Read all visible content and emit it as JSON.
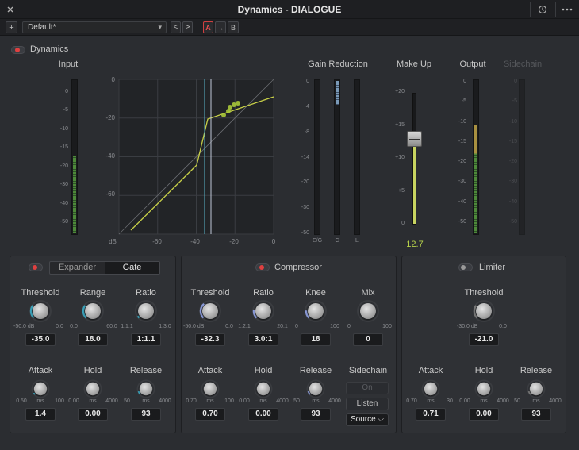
{
  "window": {
    "title": "Dynamics - DIALOGUE"
  },
  "icons": {
    "close": "close-icon",
    "history": "history-icon",
    "more": "more-icon",
    "add": "plus-icon"
  },
  "presetbar": {
    "add_label": "+",
    "preset": "Default*",
    "prev": "<",
    "next": ">",
    "a": "A",
    "arrow": "→",
    "b": "B"
  },
  "header": {
    "dynamics_label": "Dynamics",
    "dynamics_on": true
  },
  "meters": {
    "input": {
      "title": "Input",
      "scale": [
        "0",
        "-5",
        "-10",
        "-15",
        "-20",
        "-30",
        "-40",
        "-50"
      ],
      "level": 0.5
    },
    "gain_reduction": {
      "title": "Gain Reduction",
      "scale": [
        "0",
        "-4",
        "-8",
        "-14",
        "-20",
        "-30",
        "-50"
      ],
      "col_labels": [
        "E/G",
        "C",
        "L"
      ]
    },
    "makeup": {
      "title": "Make Up",
      "scale": [
        "+20",
        "+15",
        "+10",
        "+5",
        "0"
      ],
      "value": "12.7"
    },
    "output": {
      "title": "Output",
      "scale": [
        "0",
        "-5",
        "-10",
        "-15",
        "-20",
        "-30",
        "-40",
        "-50"
      ],
      "level": 0.7
    },
    "sidechain": {
      "title": "Sidechain",
      "scale": [
        "0",
        "-5",
        "-10",
        "-15",
        "-20",
        "-30",
        "-40",
        "-50"
      ]
    }
  },
  "graph": {
    "ratio_label": "1:1",
    "y_ticks": [
      "0",
      "-20",
      "-40",
      "-60"
    ],
    "x_ticks": [
      "dB",
      "-60",
      "-40",
      "-20",
      "0"
    ]
  },
  "expander_gate": {
    "mode_options": [
      "Expander",
      "Gate"
    ],
    "active_mode": "Gate",
    "on": true,
    "threshold": {
      "label": "Threshold",
      "min": "-50.0 dB",
      "max": "0.0",
      "value": "-35.0"
    },
    "range": {
      "label": "Range",
      "min": "0.0",
      "max": "60.0",
      "value": "18.0"
    },
    "ratio": {
      "label": "Ratio",
      "min": "1:1:1",
      "max": "1:3.0",
      "value": "1:1.1"
    },
    "attack": {
      "label": "Attack",
      "min": "0.50",
      "unit": "ms",
      "max": "100",
      "value": "1.4"
    },
    "hold": {
      "label": "Hold",
      "min": "0.00",
      "unit": "ms",
      "max": "4000",
      "value": "0.00"
    },
    "release": {
      "label": "Release",
      "min": "50",
      "unit": "ms",
      "max": "4000",
      "value": "93"
    }
  },
  "compressor": {
    "title": "Compressor",
    "on": true,
    "threshold": {
      "label": "Threshold",
      "min": "-50.0 dB",
      "max": "0.0",
      "value": "-32.3"
    },
    "ratio": {
      "label": "Ratio",
      "min": "1.2:1",
      "max": "20:1",
      "value": "3.0:1"
    },
    "knee": {
      "label": "Knee",
      "min": "0",
      "max": "100",
      "value": "18"
    },
    "mix": {
      "label": "Mix",
      "min": "0",
      "max": "100",
      "value": "0"
    },
    "attack": {
      "label": "Attack",
      "min": "0.70",
      "unit": "ms",
      "max": "100",
      "value": "0.70"
    },
    "hold": {
      "label": "Hold",
      "min": "0.00",
      "unit": "ms",
      "max": "4000",
      "value": "0.00"
    },
    "release": {
      "label": "Release",
      "min": "50",
      "unit": "ms",
      "max": "4000",
      "value": "93"
    },
    "sidechain": {
      "label": "Sidechain",
      "on_label": "On",
      "listen_label": "Listen",
      "source_label": "Source"
    }
  },
  "limiter": {
    "title": "Limiter",
    "on": false,
    "threshold": {
      "label": "Threshold",
      "min": "-30.0 dB",
      "max": "0.0",
      "value": "-21.0"
    },
    "attack": {
      "label": "Attack",
      "min": "0.70",
      "unit": "ms",
      "max": "30",
      "value": "0.71"
    },
    "hold": {
      "label": "Hold",
      "min": "0.00",
      "unit": "ms",
      "max": "4000",
      "value": "0.00"
    },
    "release": {
      "label": "Release",
      "min": "50",
      "unit": "ms",
      "max": "4000",
      "value": "93"
    }
  }
}
